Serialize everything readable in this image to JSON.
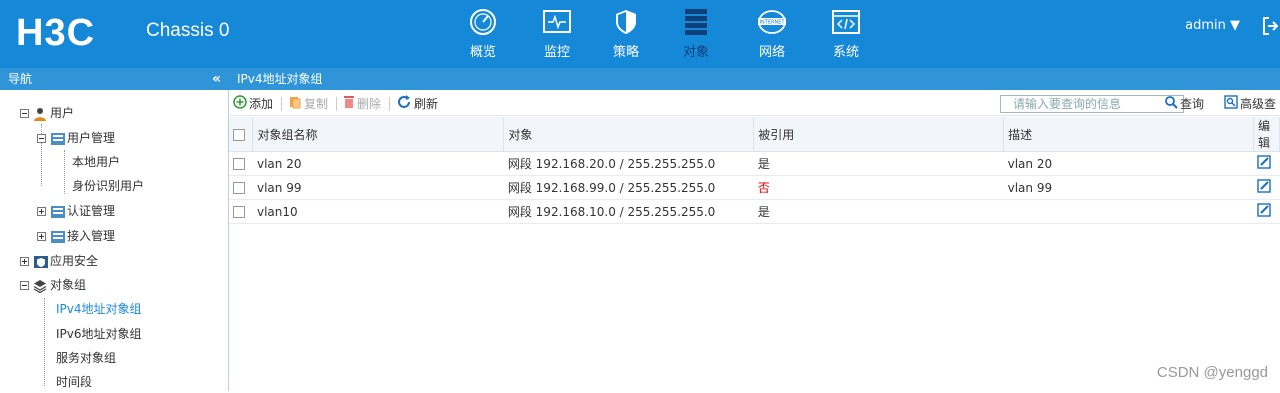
{
  "header": {
    "logo": "H3C",
    "title": "Chassis 0",
    "user": "admin",
    "nav": [
      {
        "label": "概览",
        "icon": "dashboard-icon"
      },
      {
        "label": "监控",
        "icon": "monitor-icon"
      },
      {
        "label": "策略",
        "icon": "shield-icon"
      },
      {
        "label": "对象",
        "icon": "object-icon"
      },
      {
        "label": "网络",
        "icon": "internet-icon"
      },
      {
        "label": "系统",
        "icon": "code-icon"
      }
    ],
    "internet_text": "INTERNET"
  },
  "sidebar": {
    "title": "导航",
    "items": [
      {
        "label": "用户"
      },
      {
        "label": "用户管理"
      },
      {
        "label": "本地用户"
      },
      {
        "label": "身份识别用户"
      },
      {
        "label": "认证管理"
      },
      {
        "label": "接入管理"
      },
      {
        "label": "应用安全"
      },
      {
        "label": "对象组"
      },
      {
        "label": "IPv4地址对象组"
      },
      {
        "label": "IPv6地址对象组"
      },
      {
        "label": "服务对象组"
      },
      {
        "label": "时间段"
      }
    ]
  },
  "content": {
    "title": "IPv4地址对象组",
    "toolbar": {
      "add": "添加",
      "copy": "复制",
      "delete": "删除",
      "refresh": "刷新",
      "search_placeholder": "请输入要查询的信息",
      "query": "查询",
      "advanced": "高级查"
    },
    "columns": [
      "对象组名称",
      "对象",
      "被引用",
      "描述",
      "编辑"
    ],
    "rows": [
      {
        "name": "vlan 20",
        "object": "网段 192.168.20.0 / 255.255.255.0",
        "referenced": "是",
        "desc": "vlan 20"
      },
      {
        "name": "vlan 99",
        "object": "网段 192.168.99.0 / 255.255.255.0",
        "referenced": "否",
        "desc": "vlan 99"
      },
      {
        "name": "vlan10",
        "object": "网段 192.168.10.0 / 255.255.255.0",
        "referenced": "是",
        "desc": ""
      }
    ]
  },
  "watermark": "CSDN @yenggd",
  "colors": {
    "header": "#1688d8",
    "bar": "#3094d9",
    "selected": "#1a8ade",
    "no": "#d40000"
  }
}
